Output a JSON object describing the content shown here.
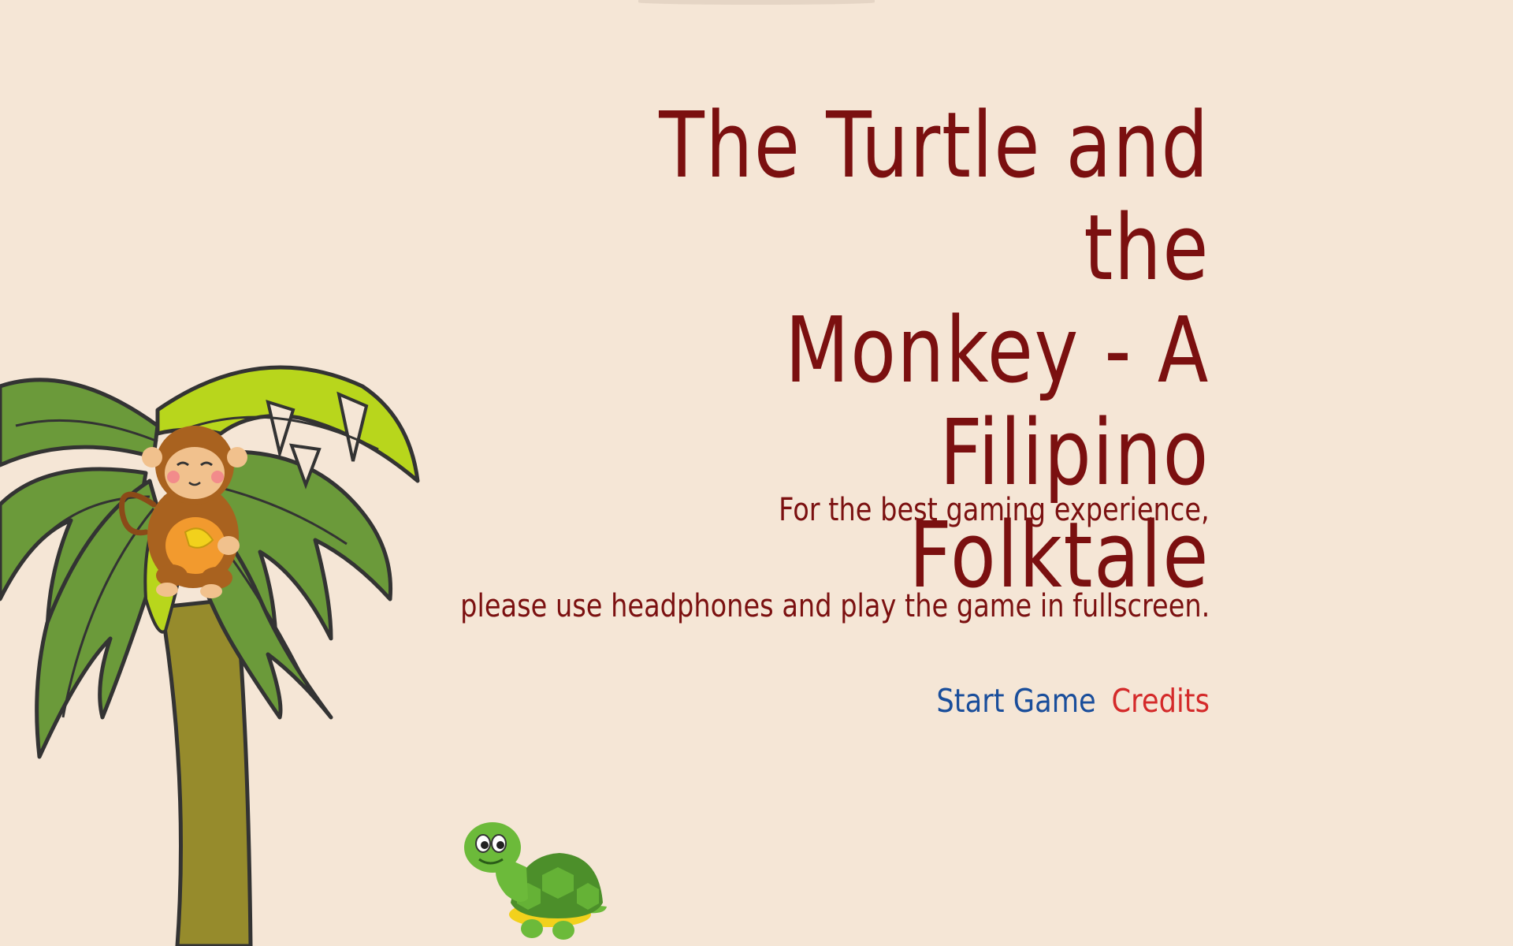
{
  "title": {
    "line1": "The Turtle and the",
    "line2": "Monkey - A Filipino",
    "line3": "Folktale"
  },
  "subtitle": {
    "line1": "For the best gaming experience,",
    "line2": "please use headphones and play the game in fullscreen."
  },
  "menu": {
    "start_label": "Start Game",
    "credits_label": "Credits"
  },
  "colors": {
    "background": "#f5e6d6",
    "title": "#7b1010",
    "start_link": "#1a4e9b",
    "credits_link": "#d42a2a"
  },
  "icons": {
    "tree": "palm-tree-icon",
    "monkey": "monkey-icon",
    "turtle": "turtle-icon"
  }
}
